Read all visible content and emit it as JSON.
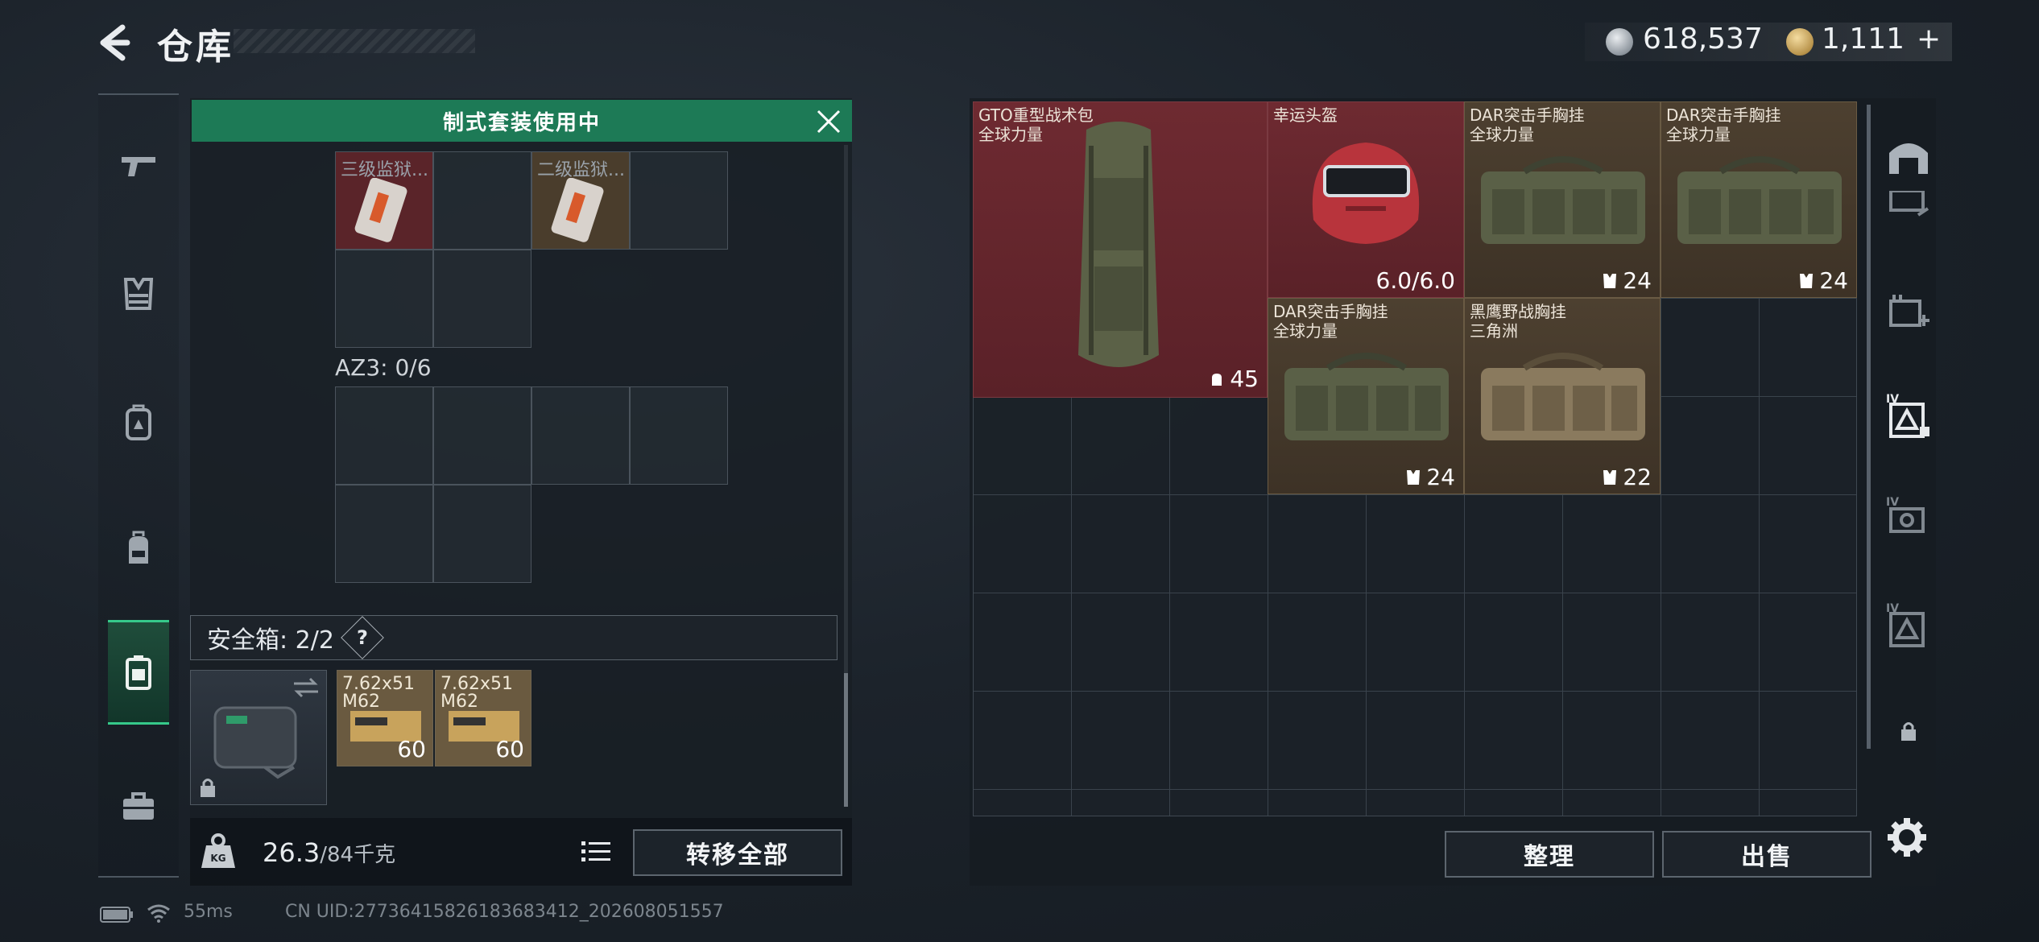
{
  "header": {
    "title": "仓库",
    "silver_amount": "618,537",
    "gold_amount": "1,111",
    "gold_plus": "+"
  },
  "sidebar": {
    "items": [
      {
        "icon": "rifle-icon"
      },
      {
        "icon": "vest-icon"
      },
      {
        "icon": "backpack-armor-icon"
      },
      {
        "icon": "backpack-icon"
      },
      {
        "icon": "safe-box-icon",
        "active": true
      },
      {
        "icon": "briefcase-icon"
      }
    ]
  },
  "loadout": {
    "banner": "制式套装使用中",
    "top_items": [
      "三级监狱...",
      "二级监狱..."
    ],
    "az3_label": "AZ3: 0/6",
    "safe_label": "安全箱: 2/2",
    "help": "?",
    "ammo": [
      {
        "name": "7.62x51",
        "variant": "M62",
        "count": "60"
      },
      {
        "name": "7.62x51",
        "variant": "M62",
        "count": "60"
      }
    ],
    "weight_current": "26.3",
    "weight_max": "/84千克",
    "transfer_all": "转移全部"
  },
  "stash": {
    "items": [
      {
        "name": "GTO重型战术包",
        "sub": "全球力量",
        "stat": "45",
        "icon": "backpack-stat-icon"
      },
      {
        "name": "幸运头盔",
        "sub": "",
        "stat": "6.0/6.0"
      },
      {
        "name": "DAR突击手胸挂",
        "sub": "全球力量",
        "stat": "24",
        "icon": "vest-stat-icon"
      },
      {
        "name": "DAR突击手胸挂",
        "sub": "全球力量",
        "stat": "24",
        "icon": "vest-stat-icon"
      },
      {
        "name": "DAR突击手胸挂",
        "sub": "全球力量",
        "stat": "24",
        "icon": "vest-stat-icon"
      },
      {
        "name": "黑鹰野战胸挂",
        "sub": "三角洲",
        "stat": "22",
        "icon": "vest-stat-icon"
      }
    ],
    "sort": "整理",
    "sell": "出售"
  },
  "status_bar": {
    "ping": "55ms",
    "uid": "CN UID:27736415826183683412_202608051557"
  },
  "colors": {
    "accent_green": "#1d7a56",
    "item_red": "#6e2a31",
    "item_tan": "#4d4030"
  }
}
